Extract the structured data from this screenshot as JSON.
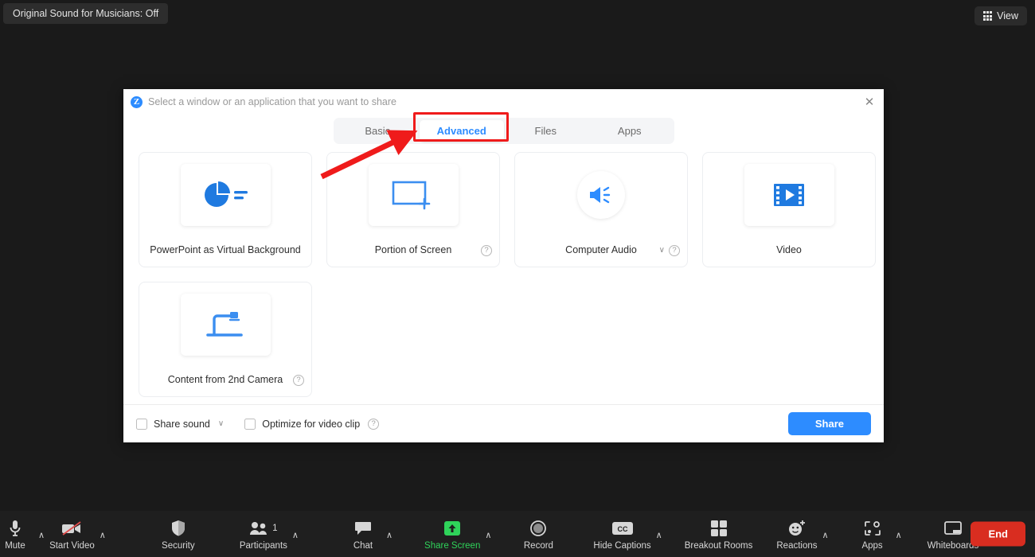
{
  "top": {
    "sound_badge": "Original Sound for Musicians: Off",
    "view_label": "View",
    "view_icon": "grid-icon"
  },
  "dialog": {
    "title": "Select a window or an application that you want to share",
    "logo_letter": "Z",
    "close_icon": "close-icon",
    "tabs": [
      {
        "label": "Basic",
        "active": false
      },
      {
        "label": "Advanced",
        "active": true
      },
      {
        "label": "Files",
        "active": false
      },
      {
        "label": "Apps",
        "active": false
      }
    ],
    "cards": [
      {
        "label": "PowerPoint as Virtual Background",
        "icon": "pie-chart-icon",
        "help": false,
        "chevron": false
      },
      {
        "label": "Portion of Screen",
        "icon": "rectangle-plus-icon",
        "help": true,
        "help_glyph": "?",
        "chevron": false
      },
      {
        "label": "Computer Audio",
        "icon": "speaker-icon",
        "help": true,
        "help_glyph": "?",
        "chevron": true,
        "chevron_glyph": "∨"
      },
      {
        "label": "Video",
        "icon": "film-strip-icon",
        "help": false,
        "chevron": false
      },
      {
        "label": "Content from 2nd Camera",
        "icon": "document-camera-icon",
        "help": true,
        "help_glyph": "?",
        "chevron": false
      }
    ],
    "footer": {
      "share_sound_label": "Share sound",
      "share_sound_checked": false,
      "share_sound_chevron": "∨",
      "optimize_label": "Optimize for video clip",
      "optimize_checked": false,
      "optimize_help_glyph": "?",
      "share_button": "Share"
    }
  },
  "annotation": {
    "box_color": "#ef1b1b",
    "arrow_color": "#ef1b1b",
    "target": "Advanced"
  },
  "toolbar": {
    "items": [
      {
        "label": "Mute",
        "icon": "microphone-icon",
        "caret": true,
        "green": false
      },
      {
        "label": "Start Video",
        "icon": "video-off-icon",
        "caret": true,
        "green": false
      },
      {
        "label": "Security",
        "icon": "shield-icon",
        "caret": false,
        "green": false
      },
      {
        "label": "Participants",
        "icon": "participants-icon",
        "caret": true,
        "green": false,
        "badge": "1"
      },
      {
        "label": "Chat",
        "icon": "chat-bubble-icon",
        "caret": true,
        "green": false
      },
      {
        "label": "Share Screen",
        "icon": "share-screen-icon",
        "caret": true,
        "green": true
      },
      {
        "label": "Record",
        "icon": "record-icon",
        "caret": false,
        "green": false
      },
      {
        "label": "Hide Captions",
        "icon": "closed-caption-icon",
        "caret": true,
        "green": false
      },
      {
        "label": "Breakout Rooms",
        "icon": "breakout-rooms-icon",
        "caret": false,
        "green": false
      },
      {
        "label": "Reactions",
        "icon": "reactions-icon",
        "caret": true,
        "green": false
      },
      {
        "label": "Apps",
        "icon": "apps-icon",
        "caret": true,
        "green": false
      },
      {
        "label": "Whiteboards",
        "icon": "whiteboard-icon",
        "caret": true,
        "green": false
      }
    ],
    "end_button": "End",
    "caret_glyph": "∧"
  },
  "colors": {
    "accent_blue": "#2d8cff",
    "active_green": "#2fd35a",
    "end_red": "#d92d20",
    "annotation_red": "#ef1b1b",
    "page_bg": "#1a1a1a",
    "toolbar_bg": "#1f1f1f"
  }
}
